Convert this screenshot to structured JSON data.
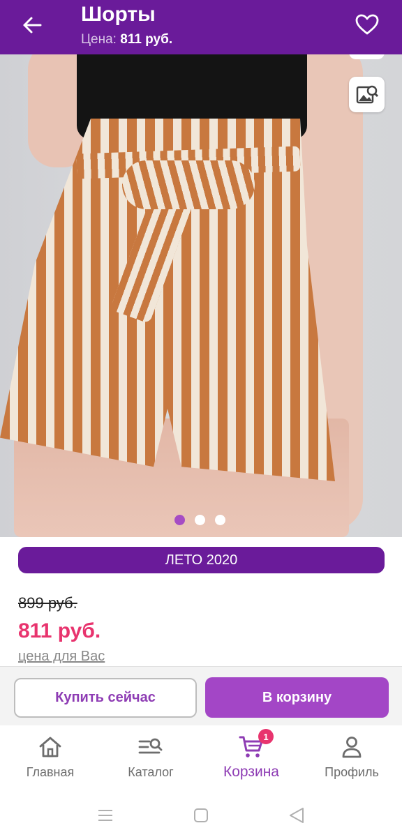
{
  "header": {
    "title": "Шорты",
    "price_label": "Цена:",
    "price_value": "811 руб."
  },
  "gallery": {
    "pages": 3,
    "active_page": 1
  },
  "product": {
    "collection_label": "ЛЕТО 2020",
    "old_price": "899 руб.",
    "new_price": "811 руб.",
    "price_note": "цена для Вас"
  },
  "actions": {
    "buy_now": "Купить сейчас",
    "add_to_cart": "В корзину"
  },
  "bottom_nav": {
    "items": [
      {
        "label": "Главная",
        "icon": "home-icon"
      },
      {
        "label": "Каталог",
        "icon": "catalog-search-icon"
      },
      {
        "label": "Корзина",
        "icon": "cart-icon",
        "badge": "1",
        "active": true
      },
      {
        "label": "Профиль",
        "icon": "profile-icon"
      }
    ]
  },
  "colors": {
    "header_bg": "#6a1b9a",
    "accent": "#a346c6",
    "price": "#e8346e"
  }
}
